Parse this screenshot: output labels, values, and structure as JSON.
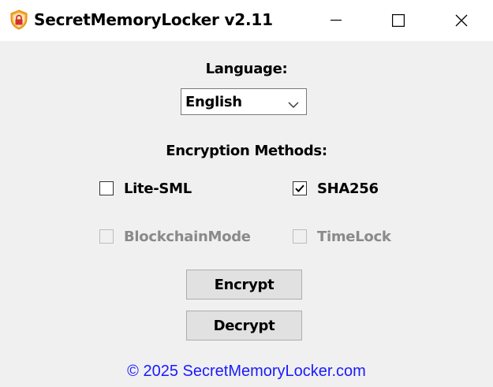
{
  "window": {
    "title": "SecretMemoryLocker v2.11",
    "controls": {
      "minimize": "minimize-icon",
      "maximize": "maximize-icon",
      "close": "close-icon"
    }
  },
  "language": {
    "label": "Language:",
    "selected": "English"
  },
  "encryption": {
    "label": "Encryption Methods:",
    "methods": [
      {
        "label": "Lite-SML",
        "checked": false,
        "enabled": true
      },
      {
        "label": "SHA256",
        "checked": true,
        "enabled": true
      },
      {
        "label": "BlockchainMode",
        "checked": false,
        "enabled": false
      },
      {
        "label": "TimeLock",
        "checked": false,
        "enabled": false
      }
    ]
  },
  "actions": {
    "encrypt_label": "Encrypt",
    "decrypt_label": "Decrypt"
  },
  "footer": {
    "link_text": "© 2025 SecretMemoryLocker.com",
    "link_color": "#1a1aff"
  },
  "colors": {
    "window_bg": "#f0f0f0",
    "titlebar_bg": "#ffffff",
    "icon_shield": "#f5a623",
    "icon_lock": "#d32f2f",
    "disabled_text": "#8a8a8a"
  }
}
